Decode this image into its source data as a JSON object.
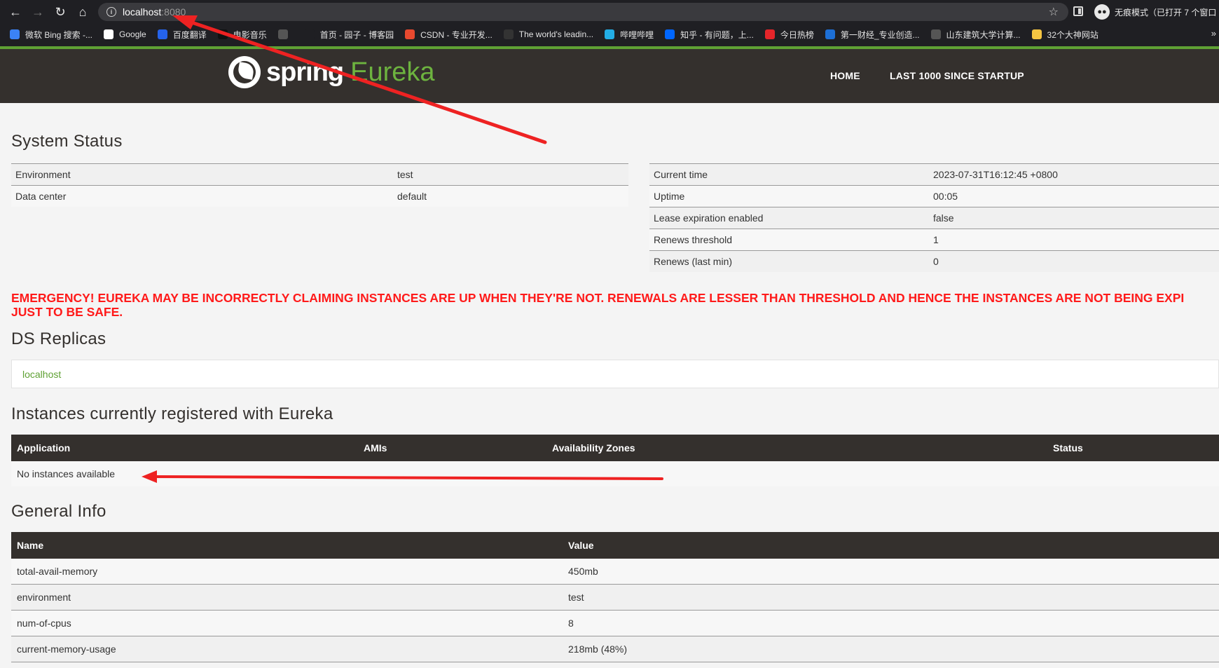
{
  "browser": {
    "url_host": "localhost",
    "url_port": ":8080",
    "incognito_label": "无痕模式（已打开 7 个窗口",
    "bookmarks": [
      {
        "label": "微软 Bing 搜索 -...",
        "icon": "search-icon",
        "color": "#3b82f6"
      },
      {
        "label": "Google",
        "icon": "google-icon",
        "color": "#ffffff"
      },
      {
        "label": "百度翻译",
        "icon": "translate-icon",
        "color": "#2563eb"
      },
      {
        "label": "电影音乐",
        "icon": "music-icon",
        "color": "#111111"
      },
      {
        "label": "",
        "icon": "globe-icon",
        "color": "#555555"
      },
      {
        "label": "首页 - 园子 - 博客园",
        "icon": "blog-icon",
        "color": "#1f1f23"
      },
      {
        "label": "CSDN - 专业开发...",
        "icon": "csdn-icon",
        "color": "#e8492f"
      },
      {
        "label": "The world's leadin...",
        "icon": "github-icon",
        "color": "#333333"
      },
      {
        "label": "哔哩哔哩",
        "icon": "bilibili-icon",
        "color": "#23ade5"
      },
      {
        "label": "知乎 - 有问题，上...",
        "icon": "zhihu-icon",
        "color": "#0066ff"
      },
      {
        "label": "今日热榜",
        "icon": "rebang-icon",
        "color": "#e5252a"
      },
      {
        "label": "第一财经_专业创造...",
        "icon": "finance-icon",
        "color": "#1d6fd6"
      },
      {
        "label": "山东建筑大学计算...",
        "icon": "globe-icon",
        "color": "#555555"
      },
      {
        "label": "32个大神网站",
        "icon": "folder-icon",
        "color": "#f5c542"
      }
    ],
    "bookmarks_more": "»"
  },
  "header": {
    "logo_spring": "spring",
    "logo_eureka": "Eureka",
    "nav": [
      "HOME",
      "LAST 1000 SINCE STARTUP"
    ]
  },
  "system_status": {
    "title": "System Status",
    "left": [
      {
        "key": "Environment",
        "value": "test"
      },
      {
        "key": "Data center",
        "value": "default"
      }
    ],
    "right": [
      {
        "key": "Current time",
        "value": "2023-07-31T16:12:45 +0800"
      },
      {
        "key": "Uptime",
        "value": "00:05"
      },
      {
        "key": "Lease expiration enabled",
        "value": "false"
      },
      {
        "key": "Renews threshold",
        "value": "1"
      },
      {
        "key": "Renews (last min)",
        "value": "0"
      }
    ]
  },
  "emergency": {
    "line1": "EMERGENCY! EUREKA MAY BE INCORRECTLY CLAIMING INSTANCES ARE UP WHEN THEY'RE NOT. RENEWALS ARE LESSER THAN THRESHOLD AND HENCE THE INSTANCES ARE NOT BEING EXPI",
    "line2": "JUST TO BE SAFE."
  },
  "ds_replicas": {
    "title": "DS Replicas",
    "items": [
      "localhost"
    ]
  },
  "instances": {
    "title": "Instances currently registered with Eureka",
    "columns": [
      "Application",
      "AMIs",
      "Availability Zones",
      "Status"
    ],
    "empty_text": "No instances available"
  },
  "general_info": {
    "title": "General Info",
    "columns": [
      "Name",
      "Value"
    ],
    "rows": [
      {
        "name": "total-avail-memory",
        "value": "450mb"
      },
      {
        "name": "environment",
        "value": "test"
      },
      {
        "name": "num-of-cpus",
        "value": "8"
      },
      {
        "name": "current-memory-usage",
        "value": "218mb (48%)"
      }
    ]
  },
  "annotation_color": "#ee2222"
}
